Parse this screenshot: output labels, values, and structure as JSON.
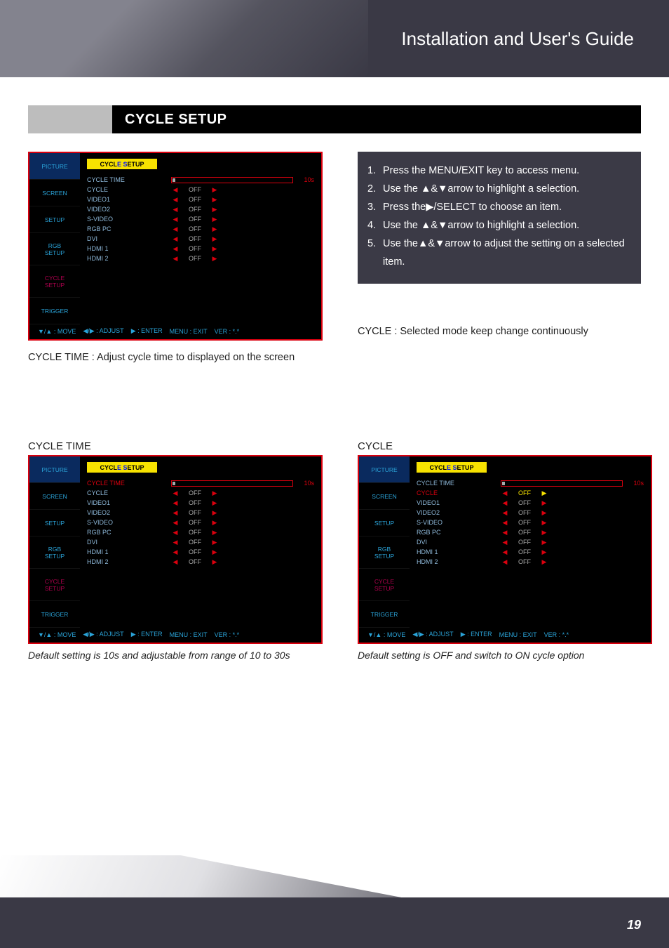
{
  "header": {
    "title": "Installation and User's Guide"
  },
  "section_title": "CYCLE SETUP",
  "osd_common": {
    "tabs": [
      "PICTURE",
      "SCREEN",
      "SETUP",
      "RGB\nSETUP",
      "CYCLE\nSETUP",
      "TRIGGER"
    ],
    "title_full": "CYCLE SETUP",
    "row_labels": [
      "CYCLE TIME",
      "CYCLE",
      "VIDEO1",
      "VIDEO2",
      "S-VIDEO",
      "RGB PC",
      "DVI",
      "HDMI 1",
      "HDMI 2"
    ],
    "slider_value": "10s",
    "off": "OFF",
    "hint": {
      "move": "▼/▲ : MOVE",
      "adjust": "◀/▶ : ADJUST",
      "enter": "▶ : ENTER",
      "menu": "MENU : EXIT",
      "ver": "VER : *.*"
    }
  },
  "steps": [
    "Press the MENU/EXIT key to access menu.",
    "Use the ▲&▼arrow to highlight a selection.",
    "Press the▶/SELECT to choose an item.",
    "Use the ▲&▼arrow to highlight a selection.",
    "Use the▲&▼arrow to adjust the setting on a selected item."
  ],
  "caption_left": "CYCLE TIME : Adjust cycle time to displayed on the screen",
  "caption_right": "CYCLE : Selected mode keep change continuously",
  "sub1": {
    "title": "CYCLE TIME",
    "highlight_row": "CYCLE TIME",
    "note": "Default setting is 10s and adjustable from range of 10 to 30s"
  },
  "sub2": {
    "title": "CYCLE",
    "highlight_row": "CYCLE",
    "note": "Default setting is OFF and switch to ON cycle option"
  },
  "page_number": "19"
}
